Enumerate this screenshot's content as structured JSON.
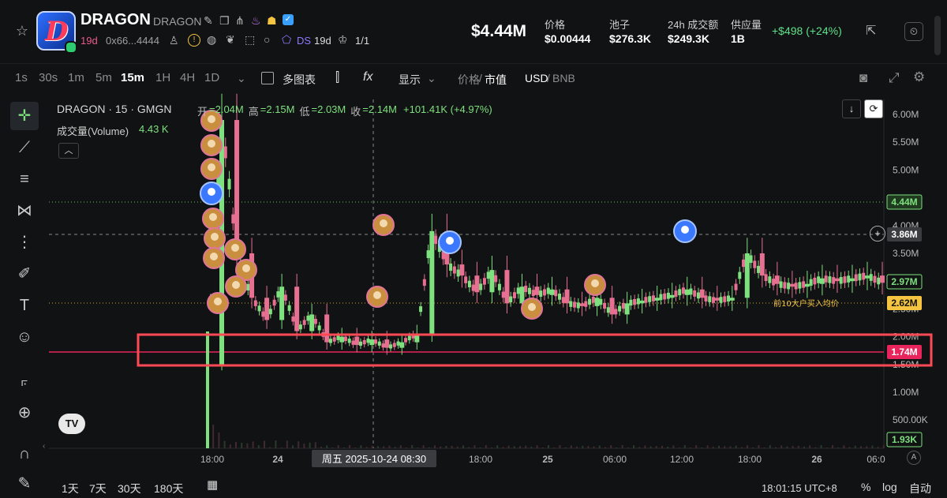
{
  "header": {
    "token_name": "DRAGON",
    "token_symbol": "DRAGON",
    "age": "19d",
    "address": "0x66...4444",
    "ds_label": "DS",
    "ds_age": "19d",
    "holders_ratio": "1/1",
    "market_cap": "$4.44M",
    "stats": [
      {
        "label": "价格",
        "value": "$0.00444"
      },
      {
        "label": "池子",
        "value": "$276.3K"
      },
      {
        "label": "24h 成交额",
        "value": "$249.3K"
      },
      {
        "label": "供应量",
        "value": "1B"
      }
    ],
    "pnl": "+$498 (+24%)"
  },
  "toolbar": {
    "timeframes": [
      "1s",
      "30s",
      "1m",
      "5m",
      "15m",
      "1H",
      "4H",
      "1D"
    ],
    "active_timeframe": "15m",
    "multi_chart": "多图表",
    "display": "显示",
    "price_label": "价格",
    "mcap_label": "市值",
    "currency_usd": "USD",
    "currency_bnb": "BNB"
  },
  "legend": {
    "title": "DRAGON · 15 · GMGN",
    "open_label": "开",
    "open": "=2.04M",
    "high_label": "高",
    "high": "=2.15M",
    "low_label": "低",
    "low": "=2.03M",
    "close_label": "收",
    "close": "=2.14M",
    "change": "+101.41K (+4.97%)",
    "volume_label": "成交量(Volume)",
    "volume_value": "4.43 K"
  },
  "chart_data": {
    "type": "candlestick",
    "y_axis_labels": [
      "6.00M",
      "5.50M",
      "5.00M",
      "4.00M",
      "3.50M",
      "2.50M",
      "2.00M",
      "1.50M",
      "1.00M",
      "500.00K"
    ],
    "y_axis_values": [
      6000000,
      5500000,
      5000000,
      4000000,
      3500000,
      2500000,
      2000000,
      1500000,
      1000000,
      500000
    ],
    "x_axis_labels": [
      "18:00",
      "24",
      "18:00",
      "25",
      "06:00",
      "12:00",
      "18:00",
      "26",
      "06:0"
    ],
    "crosshair_time": "周五 2025-10-24   08:30",
    "price_tags": [
      {
        "value": "4.44M",
        "kind": "current-mcap",
        "color": "#7ee07e"
      },
      {
        "value": "3.86M",
        "kind": "crosshair",
        "color": "#ffffff"
      },
      {
        "value": "2.97M",
        "kind": "last",
        "color": "#7ee07e"
      },
      {
        "value": "2.62M",
        "kind": "top10-avg",
        "color": "#f5c542"
      },
      {
        "value": "1.74M",
        "kind": "highlight",
        "color": "#e8245c"
      },
      {
        "value": "1.93K",
        "kind": "volume",
        "color": "#7ee07e"
      }
    ],
    "annotation": "前10大户买入均价",
    "series": [
      {
        "values": [
          1500000,
          5900000,
          3500000,
          2700000,
          2300000,
          2900000,
          2100000,
          2400000,
          1900000,
          2000000,
          1850000,
          1950000,
          1800000,
          1900000,
          2050000,
          3900000,
          3300000,
          3100000,
          2800000,
          3200000,
          2600000,
          2900000,
          2750000,
          2850000,
          2600000,
          2550000,
          2700000,
          2400000,
          2600000,
          2650000,
          2700000,
          2750000,
          2850000,
          2700000,
          2650000,
          2700000,
          3500000,
          3100000,
          2950000,
          2900000,
          2950000,
          3050000,
          3000000,
          3050000,
          3100000,
          2970000
        ]
      }
    ]
  },
  "bottom": {
    "ranges": [
      "1天",
      "7天",
      "30天",
      "180天"
    ],
    "time": "18:01:15 UTC+8",
    "percent": "%",
    "log": "log",
    "auto": "自动"
  }
}
